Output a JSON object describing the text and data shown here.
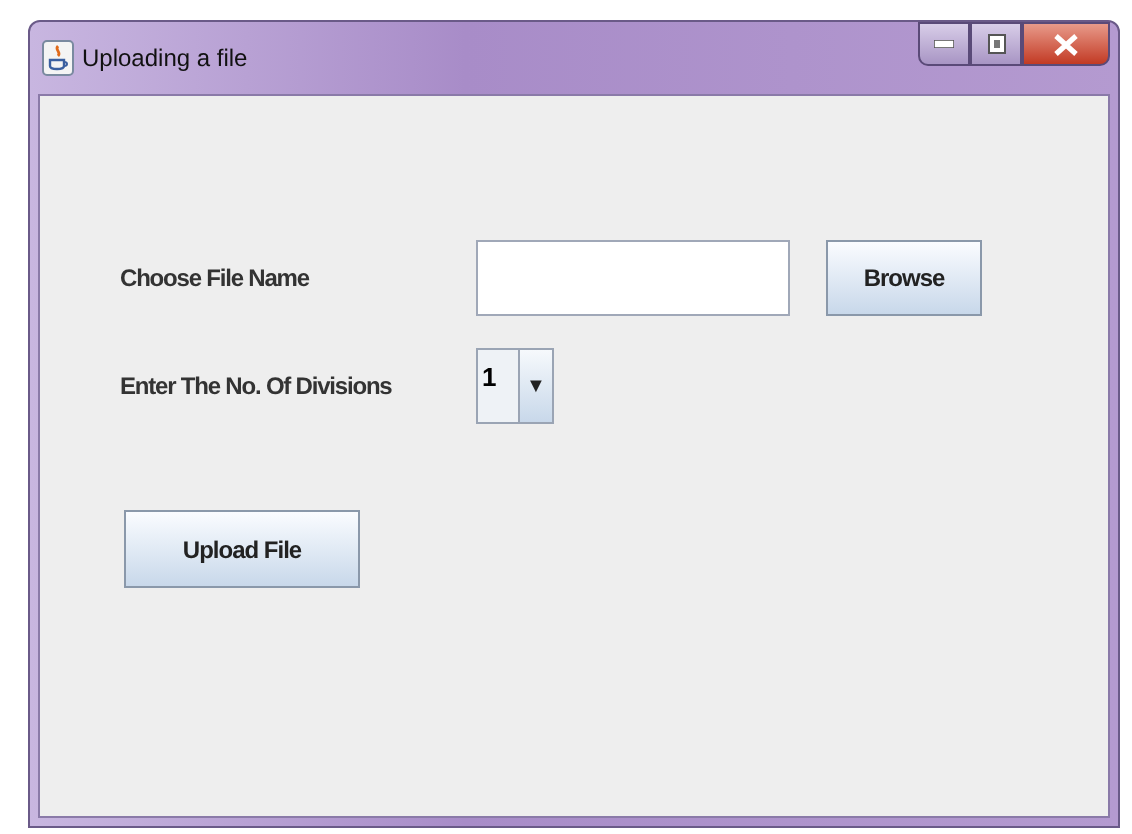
{
  "window": {
    "title": "Uploading a file"
  },
  "form": {
    "file_label": "Choose File Name",
    "browse_button": "Browse",
    "divisions_label": "Enter The No. Of Divisions",
    "divisions_select": {
      "value": "1",
      "arrow": "▼"
    },
    "upload_button": "Upload File"
  }
}
